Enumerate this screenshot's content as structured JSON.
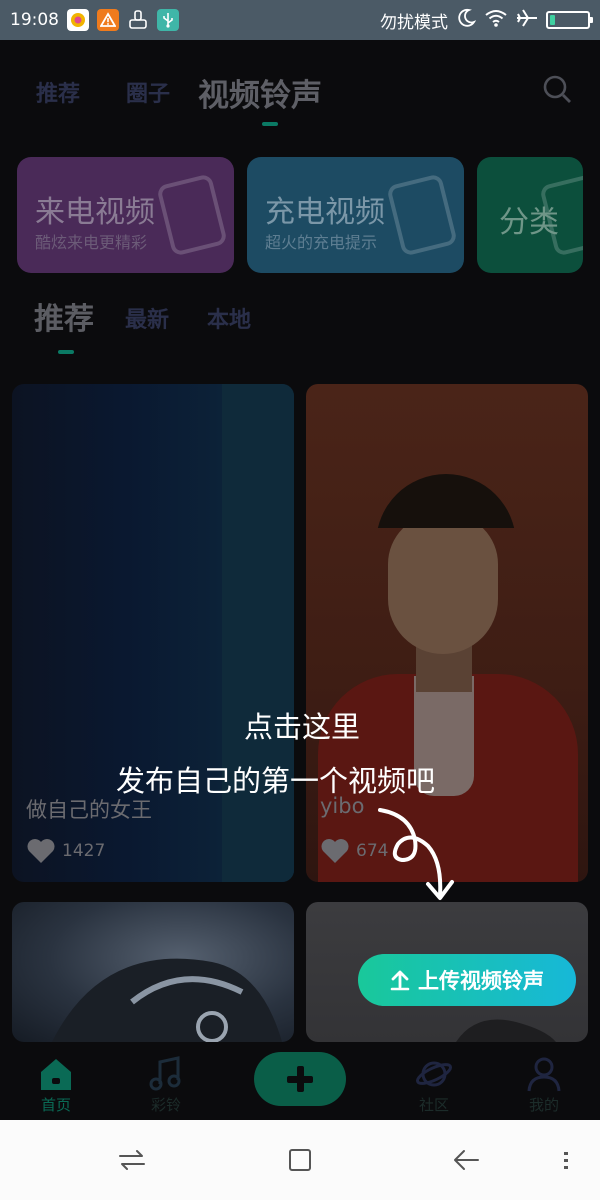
{
  "status_bar": {
    "time": "19:08",
    "dnd_label": "勿扰模式",
    "battery_level": 0.15,
    "icons": [
      "app-notification-icon",
      "warning-icon",
      "cleaner-icon",
      "usb-icon",
      "moon-icon",
      "wifi-icon",
      "airplane-icon",
      "battery-icon"
    ]
  },
  "header": {
    "tabs": [
      {
        "label": "推荐"
      },
      {
        "label": "圈子"
      },
      {
        "label": "视频铃声"
      }
    ],
    "active_tab": 2
  },
  "categories": [
    {
      "title": "来电视频",
      "subtitle": "酷炫来电更精彩"
    },
    {
      "title": "充电视频",
      "subtitle": "超火的充电提示"
    },
    {
      "title": "分类"
    }
  ],
  "sub_tabs": [
    {
      "label": "推荐"
    },
    {
      "label": "最新"
    },
    {
      "label": "本地"
    }
  ],
  "videos": [
    {
      "title": "做自己的女王",
      "likes": "1427"
    },
    {
      "title": "yibo",
      "likes": "674"
    },
    {
      "title": ""
    },
    {
      "title": ""
    }
  ],
  "overlay": {
    "line1": "点击这里",
    "line2": "发布自己的第一个视频吧"
  },
  "upload_button": {
    "label": "上传视频铃声"
  },
  "bottom_nav": [
    {
      "label": "首页"
    },
    {
      "label": "彩铃"
    },
    {
      "label": ""
    },
    {
      "label": "社区"
    },
    {
      "label": "我的"
    }
  ],
  "colors": {
    "accent": "#19c89a",
    "accent_end": "#17b8d8",
    "status_bar": "#4b5a66",
    "background": "#0b0b0d"
  }
}
